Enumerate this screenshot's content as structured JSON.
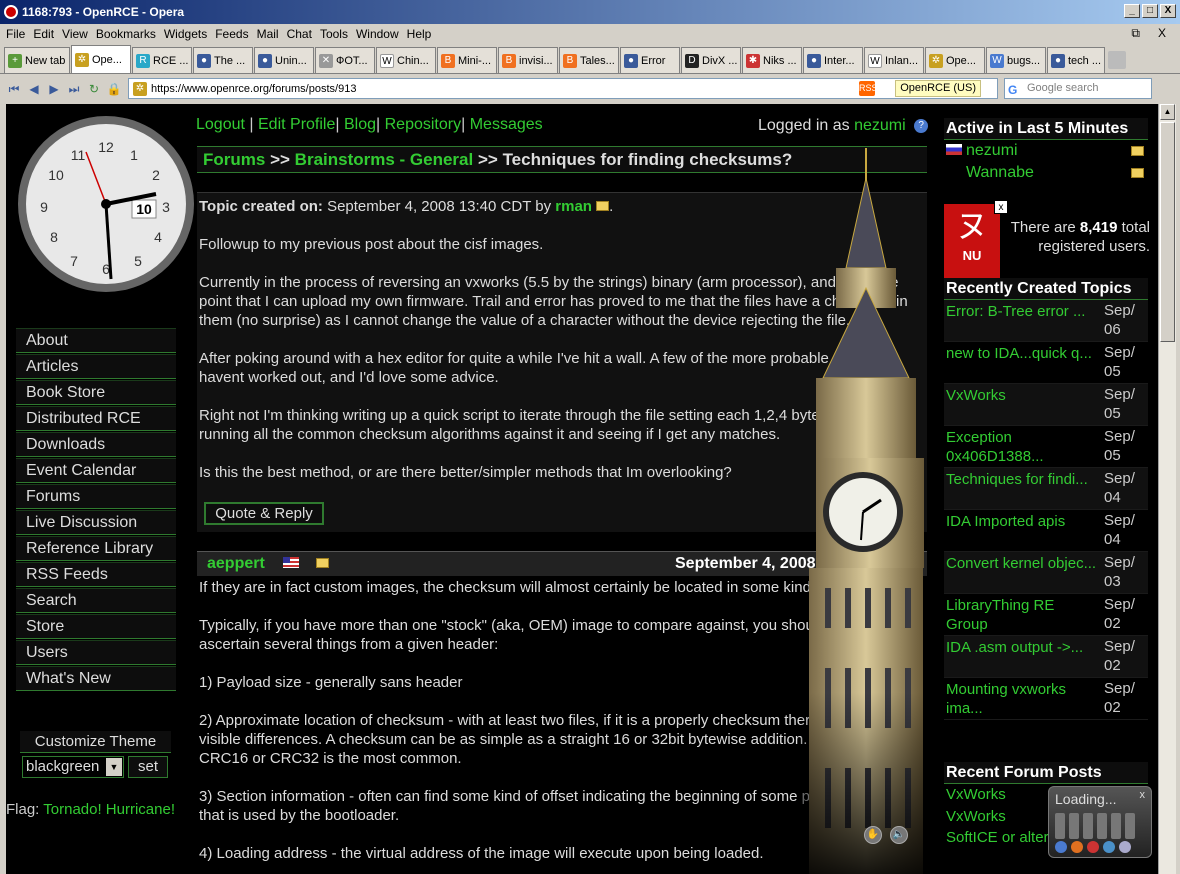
{
  "window": {
    "title": "1168:793 - OpenRCE - Opera",
    "minimize_label": "_",
    "maximize_label": "□",
    "close_label": "X"
  },
  "menu": {
    "items": [
      "File",
      "Edit",
      "View",
      "Bookmarks",
      "Widgets",
      "Feeds",
      "Mail",
      "Chat",
      "Tools",
      "Window",
      "Help"
    ],
    "restore_label": "⧉",
    "close_label": "X"
  },
  "tabs": [
    {
      "label": "New tab"
    },
    {
      "label": "Ope..."
    },
    {
      "label": "RCE ..."
    },
    {
      "label": "The ..."
    },
    {
      "label": "Unin..."
    },
    {
      "label": "ФОТ..."
    },
    {
      "label": "Chin..."
    },
    {
      "label": "Mini-..."
    },
    {
      "label": "invisi..."
    },
    {
      "label": "Tales..."
    },
    {
      "label": "Error"
    },
    {
      "label": "DivX ..."
    },
    {
      "label": "Niks ..."
    },
    {
      "label": "Inter..."
    },
    {
      "label": "Inlan..."
    },
    {
      "label": "Ope..."
    },
    {
      "label": "bugs..."
    },
    {
      "label": "tech ..."
    }
  ],
  "address": {
    "url": "https://www.openrce.org/forums/posts/913",
    "site_badge": "OpenRCE (US)",
    "search_placeholder": "Google search",
    "search_engine_letter": "G",
    "feed_label": "RSS"
  },
  "clock": {
    "numerals": [
      "12",
      "1",
      "2",
      "3",
      "4",
      "5",
      "6",
      "7",
      "8",
      "9",
      "10",
      "11"
    ],
    "date_box": "10"
  },
  "nav": {
    "items": [
      "About",
      "Articles",
      "Book Store",
      "Distributed RCE",
      "Downloads",
      "Event Calendar",
      "Forums",
      "Live Discussion",
      "Reference Library",
      "RSS Feeds",
      "Search",
      "Store",
      "Users",
      "What's New"
    ],
    "customize_label": "Customize Theme",
    "theme_value": "blackgreen",
    "set_label": "set",
    "flag_label": "Flag:",
    "flag_value": "Tornado! Hurricane!"
  },
  "toplinks": {
    "logout": "Logout",
    "edit_profile": "Edit Profile",
    "blog": "Blog",
    "repository": "Repository",
    "messages": "Messages",
    "logged_in_label": "Logged in as",
    "username": "nezumi",
    "separator": "|",
    "help_glyph": "?"
  },
  "breadcrumb": {
    "forums": "Forums",
    "sep": ">>",
    "category": "Brainstorms - General",
    "topic": "Techniques for finding checksums?"
  },
  "post1": {
    "created_label": "Topic created on:",
    "date": "September 4, 2008 13:40 CDT by",
    "author": "rman",
    "p1": "Followup to my previous post about the cisf images.",
    "p2": "Currently in the process of reversing an vxworks (5.5 by the strings) binary (arm processor), and up to the point that I can upload my own firmware.  Trail and error has proved to me that the files have a checksum in them (no surprise) as I cannot change the value of a character without the device rejecting the file.",
    "p3": "After poking around with a hex editor for quite a while I've hit a wall.  A few of the more probable options havent worked out, and I'd love some advice.",
    "p4": "Right not I'm thinking writing up a quick script to iterate through the file setting each 1,2,4 byte chunk to x00, running all the common checksum algorithms against it and seeing if I get any matches.",
    "p5": "Is this the best method, or are there better/simpler methods that Im overlooking?",
    "quote_label": "Quote & Reply"
  },
  "post2": {
    "author": "aeppert",
    "date": "September 4, 2008",
    "p1": "If they are in fact custom images, the checksum will almost certainly be located in some kind of header.",
    "p2": "Typically, if you have more than one \"stock\" (aka, OEM) image to compare against, you should be able to ascertain several things from a given header:",
    "p3": "1) Payload size - generally sans header",
    "p4": "2) Approximate location of checksum - with at least two files, if it is a properly checksum there should be visible differences.  A checksum can be as simple as a straight 16 or 32bit bytewise addition.  Generally, a CRC16 or CRC32 is the most common.",
    "p5": "3) Section information - often can find some kind of offset indicating the beginning of some pertinent section that is used by the bootloader.",
    "p6": "4) Loading address - the virtual address of the image will execute upon being loaded."
  },
  "active": {
    "heading": "Active in Last 5 Minutes",
    "users": [
      "nezumi",
      "Wannabe"
    ],
    "total_prefix": "There are",
    "total_count": "8,419",
    "total_suffix": "total registered users."
  },
  "ad": {
    "kana": "ヌ",
    "label": "NU",
    "close": "x"
  },
  "recent_topics": {
    "heading": "Recently Created Topics",
    "items": [
      {
        "title": "Error: B-Tree error ...",
        "date": "Sep/ 06"
      },
      {
        "title": "new to IDA...quick q...",
        "date": "Sep/ 05"
      },
      {
        "title": "VxWorks",
        "date": "Sep/ 05"
      },
      {
        "title": "Exception 0x406D1388...",
        "date": "Sep/ 05"
      },
      {
        "title": "Techniques for findi...",
        "date": "Sep/ 04"
      },
      {
        "title": "IDA Imported apis",
        "date": "Sep/ 04"
      },
      {
        "title": "Convert kernel objec...",
        "date": "Sep/ 03"
      },
      {
        "title": "LibraryThing RE Group",
        "date": "Sep/ 02"
      },
      {
        "title": "IDA .asm output ->...",
        "date": "Sep/ 02"
      },
      {
        "title": "Mounting vxworks ima...",
        "date": "Sep/ 02"
      }
    ]
  },
  "recent_posts": {
    "heading": "Recent Forum Posts",
    "items": [
      "VxWorks",
      "VxWorks",
      "SoftICE or alternati..."
    ]
  },
  "loading_widget": {
    "label": "Loading...",
    "close": "x"
  },
  "media": {
    "play": "✋",
    "sound": "🔈"
  },
  "colors": {
    "accent_green": "#33cc33",
    "border_green": "#2f7a2f",
    "background": "#000000"
  }
}
